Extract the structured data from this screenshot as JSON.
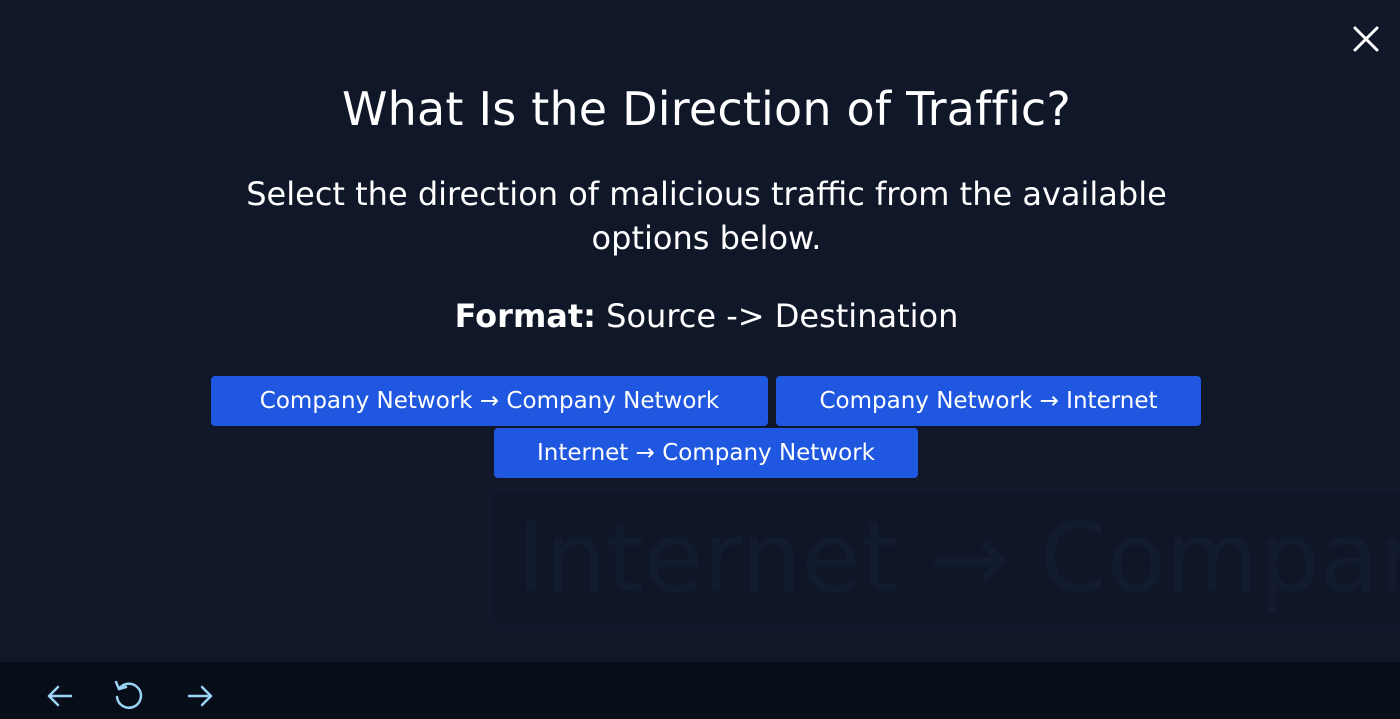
{
  "modal": {
    "title": "What Is the Direction of Traffic?",
    "instruction": "Select the direction of malicious traffic from the available options below.",
    "format_label": "Format:",
    "format_value": " Source -> Destination",
    "options": [
      {
        "label": "Company Network → Company Network"
      },
      {
        "label": "Company Network → Internet"
      },
      {
        "label": "Internet → Company Network"
      }
    ],
    "background_ghost_text": "Internet → Company"
  },
  "icons": {
    "close": "close-icon",
    "back": "arrow-left-icon",
    "replay": "replay-icon",
    "forward": "arrow-right-icon"
  },
  "colors": {
    "modal_background": "#0f1729",
    "button_primary": "#1f57e0",
    "nav_icon": "#9ad3f5",
    "text": "#ffffff"
  }
}
